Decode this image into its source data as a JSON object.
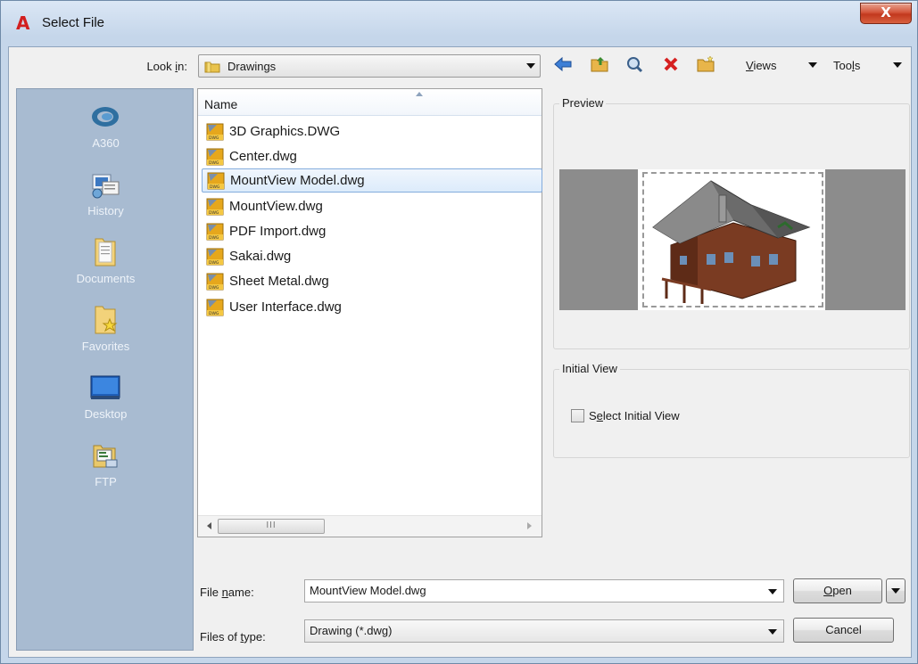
{
  "window": {
    "title": "Select File",
    "close_label": "X",
    "app_logo_letter": "A"
  },
  "toolbar": {
    "lookin_label_pre": "Look ",
    "lookin_label_key": "i",
    "lookin_label_post": "n:",
    "lookin_value": "Drawings",
    "views_key": "V",
    "views_rest": "iews",
    "tools_pre": "Too",
    "tools_key": "l",
    "tools_post": "s",
    "icons": [
      "back-arrow-icon",
      "up-one-level-icon",
      "search-web-icon",
      "delete-icon",
      "create-new-folder-icon"
    ]
  },
  "places": [
    {
      "label": "A360",
      "icon": "a360-icon"
    },
    {
      "label": "History",
      "icon": "history-icon"
    },
    {
      "label": "Documents",
      "icon": "documents-folder-icon"
    },
    {
      "label": "Favorites",
      "icon": "favorites-folder-icon"
    },
    {
      "label": "Desktop",
      "icon": "desktop-icon"
    },
    {
      "label": "FTP",
      "icon": "ftp-icon"
    }
  ],
  "filelist": {
    "column_name": "Name",
    "scroll_thumb_glyph": "III",
    "files": [
      {
        "name": "3D Graphics.DWG",
        "selected": false
      },
      {
        "name": "Center.dwg",
        "selected": false
      },
      {
        "name": "MountView Model.dwg",
        "selected": true
      },
      {
        "name": "MountView.dwg",
        "selected": false
      },
      {
        "name": "PDF Import.dwg",
        "selected": false
      },
      {
        "name": "Sakai.dwg",
        "selected": false
      },
      {
        "name": "Sheet Metal.dwg",
        "selected": false
      },
      {
        "name": "User Interface.dwg",
        "selected": false
      }
    ]
  },
  "preview": {
    "group_label": "Preview"
  },
  "initial_view": {
    "group_label": "Initial View",
    "checkbox_pre": "S",
    "checkbox_key": "e",
    "checkbox_post": "lect Initial View",
    "checked": false
  },
  "bottom": {
    "file_name_pre": "File ",
    "file_name_key": "n",
    "file_name_post": "ame:",
    "file_name_value": "MountView Model.dwg",
    "file_type_pre": "Files of ",
    "file_type_key": "t",
    "file_type_post": "ype:",
    "file_type_value": "Drawing (*.dwg)",
    "open_key": "O",
    "open_rest": "pen",
    "cancel_label": "Cancel"
  }
}
